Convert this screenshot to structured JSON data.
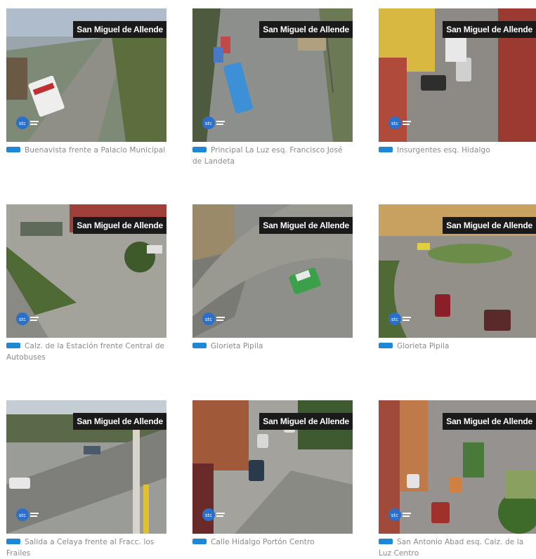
{
  "overlay_label": "San Miguel de Allende",
  "logo_text": "stc",
  "cameras": [
    {
      "caption": "Buenavista frente a Palacio Municipal"
    },
    {
      "caption": "Principal La Luz esq. Francisco José de Landeta"
    },
    {
      "caption": "Insurgentes esq. Hidalgo"
    },
    {
      "caption": "Calz. de la Estación frente Central de Autobuses"
    },
    {
      "caption": "Glorieta Pipila"
    },
    {
      "caption": "Glorieta Pipila"
    },
    {
      "caption": "Salida a Celaya frente al Fracc. los Frailes"
    },
    {
      "caption": "Calle Hidalgo Portón Centro"
    },
    {
      "caption": "San Antonio Abad esq. Calz. de la Luz Centro"
    }
  ],
  "colors": {
    "accent": "#1e88d6",
    "caption": "#8a8a8a",
    "badge_bg": "#1a1a1a"
  }
}
